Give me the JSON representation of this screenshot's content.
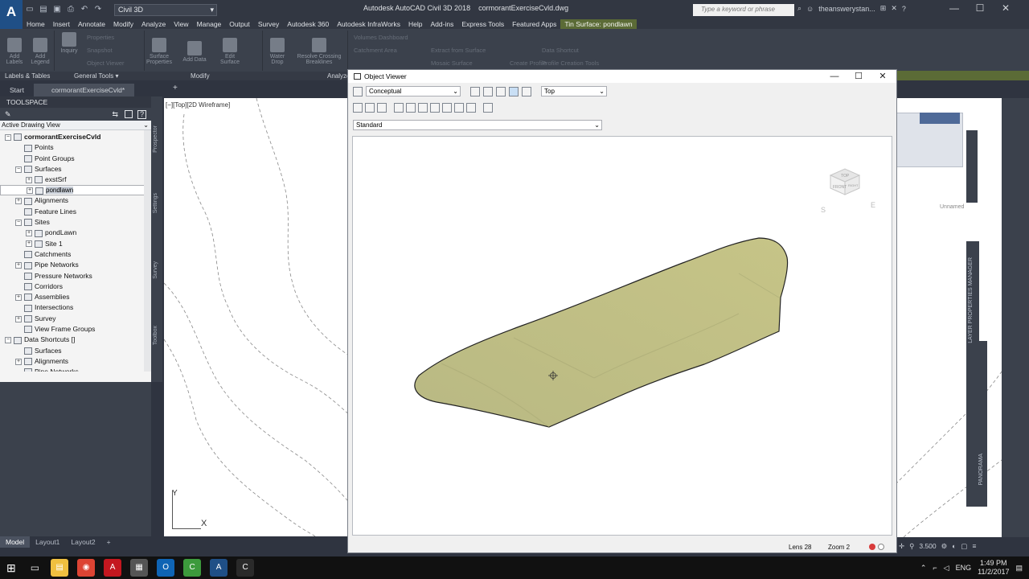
{
  "app": {
    "logo": "A",
    "workspace": "Civil 3D",
    "title": "Autodesk AutoCAD Civil 3D 2018",
    "filename": "cormorantExerciseCvld.dwg",
    "search_placeholder": "Type a keyword or phrase",
    "user": "theanswerystan...",
    "min": "—",
    "max": "☐",
    "close": "✕",
    "help": "?"
  },
  "qat": [
    {
      "icon": "new-icon",
      "glyph": "▭"
    },
    {
      "icon": "open-icon",
      "glyph": "▤"
    },
    {
      "icon": "save-icon",
      "glyph": "▣"
    },
    {
      "icon": "print-icon",
      "glyph": "⎙"
    },
    {
      "icon": "undo-icon",
      "glyph": "↶"
    },
    {
      "icon": "redo-icon",
      "glyph": "↷"
    }
  ],
  "menu": [
    "Home",
    "Insert",
    "Annotate",
    "Modify",
    "Analyze",
    "View",
    "Manage",
    "Output",
    "Survey",
    "Autodesk 360",
    "Autodesk InfraWorks",
    "Help",
    "Add-ins",
    "Express Tools",
    "Featured Apps",
    "Tin Surface: pondlawn"
  ],
  "ribbon": {
    "panels": [
      "Labels & Tables",
      "General Tools ▾",
      "Modify",
      "Analyze"
    ],
    "big_buttons": [
      "Add Labels",
      "Add Legend",
      "Inquiry",
      "Surface Properties",
      "Add Data",
      "Edit Surface",
      "Water Drop",
      "Resolve Crossing Breaklines"
    ],
    "small_items": [
      "Properties",
      "Snapshot",
      "Object Viewer",
      "Volumes Dashboard",
      "Catchment Area",
      "Extract from Surface",
      "Mosaic Surface",
      "Create Profile",
      "Data Shortcut",
      "Profile Creation Tools"
    ]
  },
  "filetabs": [
    "Start",
    "cormorantExerciseCvld*",
    "+"
  ],
  "toolspace": {
    "title": "TOOLSPACE",
    "view": "Active Drawing View",
    "tree": [
      {
        "label": "cormorantExerciseCvld",
        "level": 0,
        "exp": "−",
        "bold": true
      },
      {
        "label": "Points",
        "level": 1,
        "exp": ""
      },
      {
        "label": "Point Groups",
        "level": 1,
        "exp": ""
      },
      {
        "label": "Surfaces",
        "level": 1,
        "exp": "−"
      },
      {
        "label": "exstSrf",
        "level": 2,
        "exp": "+"
      },
      {
        "label": "pondlawn",
        "level": 2,
        "exp": "+",
        "selected": true
      },
      {
        "label": "Alignments",
        "level": 1,
        "exp": "+"
      },
      {
        "label": "Feature Lines",
        "level": 1,
        "exp": ""
      },
      {
        "label": "Sites",
        "level": 1,
        "exp": "−"
      },
      {
        "label": "pondLawn",
        "level": 2,
        "exp": "+"
      },
      {
        "label": "Site 1",
        "level": 2,
        "exp": "+"
      },
      {
        "label": "Catchments",
        "level": 1,
        "exp": ""
      },
      {
        "label": "Pipe Networks",
        "level": 1,
        "exp": "+"
      },
      {
        "label": "Pressure Networks",
        "level": 1,
        "exp": ""
      },
      {
        "label": "Corridors",
        "level": 1,
        "exp": ""
      },
      {
        "label": "Assemblies",
        "level": 1,
        "exp": "+"
      },
      {
        "label": "Intersections",
        "level": 1,
        "exp": ""
      },
      {
        "label": "Survey",
        "level": 1,
        "exp": "+"
      },
      {
        "label": "View Frame Groups",
        "level": 1,
        "exp": ""
      },
      {
        "label": "Data Shortcuts []",
        "level": 0,
        "exp": "−"
      },
      {
        "label": "Surfaces",
        "level": 1,
        "exp": ""
      },
      {
        "label": "Alignments",
        "level": 1,
        "exp": "+"
      },
      {
        "label": "Pipe Networks",
        "level": 1,
        "exp": ""
      }
    ],
    "side_tabs": [
      "Prospector",
      "Settings",
      "Survey",
      "Toolbox"
    ]
  },
  "viewport_label": "[−][Top][2D Wireframe]",
  "axis": {
    "y": "Y",
    "x": "X"
  },
  "layouts": [
    "Model",
    "Layout1",
    "Layout2",
    "+"
  ],
  "object_viewer": {
    "title": "Object Viewer",
    "visual_style": "Conceptual",
    "view": "Top",
    "style": "Standard",
    "lens": "Lens 28",
    "zoom": "Zoom 2",
    "viewcube": {
      "top": "TOP",
      "front": "FRONT",
      "right": "RIGHT"
    }
  },
  "right_panel": {
    "unnamed": "Unnamed",
    "layer_mgr": "LAYER PROPERTIES MANAGER",
    "panorama": "PANORAMA"
  },
  "status": {
    "scale": "3.500"
  },
  "taskbar": {
    "time": "1:49 PM",
    "date": "11/2/2017",
    "lang": "ENG",
    "apps": [
      {
        "icon": "file-explorer-icon",
        "color": "#f0c040",
        "glyph": "▤"
      },
      {
        "icon": "chrome-icon",
        "color": "#dd4433",
        "glyph": "◉"
      },
      {
        "icon": "acrobat-icon",
        "color": "#c4171f",
        "glyph": "A"
      },
      {
        "icon": "app-icon",
        "color": "#555",
        "glyph": "▦"
      },
      {
        "icon": "outlook-icon",
        "color": "#0f64b4",
        "glyph": "O"
      },
      {
        "icon": "camtasia-icon",
        "color": "#3c9a3c",
        "glyph": "C"
      },
      {
        "icon": "autocad-icon",
        "color": "#1f4f86",
        "glyph": "A"
      },
      {
        "icon": "cad-icon",
        "color": "#2a2a2a",
        "glyph": "C"
      }
    ]
  }
}
